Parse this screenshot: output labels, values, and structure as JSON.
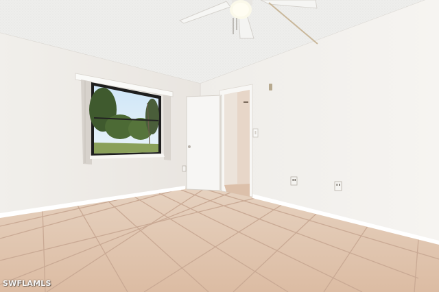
{
  "watermark": {
    "text": "SWFLAMLS"
  },
  "colors": {
    "ceiling": "#eeeeec",
    "left_wall": "#f0ede9",
    "right_wall": "#f3f1ee",
    "floor_tile": "#e2c6b0",
    "floor_grout": "#c8a892",
    "door": "#f7f6f4",
    "baseboard": "#ffffff"
  },
  "icons": [
    "ceiling-fan-icon",
    "window-icon",
    "door-icon",
    "outlet-icon",
    "light-switch-icon"
  ]
}
